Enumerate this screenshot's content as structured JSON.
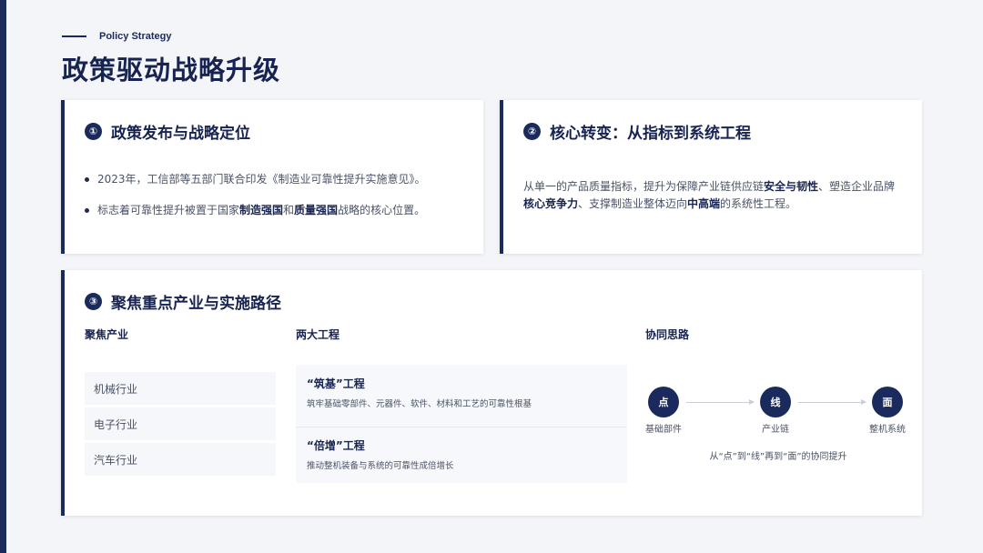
{
  "header": {
    "eyebrow": "Policy Strategy",
    "title": "政策驱动战略升级"
  },
  "card1": {
    "num": "①",
    "title": "政策发布与战略定位",
    "bullet1": "2023年，工信部等五部门联合印发《制造业可靠性提升实施意见》。",
    "bullet2_pre": "标志着可靠性提升被置于国家",
    "bullet2_b1": "制造强国",
    "bullet2_mid": "和",
    "bullet2_b2": "质量强国",
    "bullet2_post": "战略的核心位置。"
  },
  "card2": {
    "num": "②",
    "title": "核心转变：从指标到系统工程",
    "p_pre": "从单一的产品质量指标，提升为保障产业链供应链",
    "p_b1": "安全与韧性",
    "p_mid1": "、塑造企业品牌",
    "p_b2": "核心竞争力",
    "p_mid2": "、支撑制造业整体迈向",
    "p_b3": "中高端",
    "p_post": "的系统性工程。"
  },
  "card3": {
    "num": "③",
    "title": "聚焦重点产业与实施路径",
    "col1_head": "聚焦产业",
    "col2_head": "两大工程",
    "col3_head": "协同思路",
    "industries": [
      "机械行业",
      "电子行业",
      "汽车行业"
    ],
    "projects": [
      {
        "title": "“筑基”工程",
        "desc": "筑牢基础零部件、元器件、软件、材料和工艺的可靠性根基"
      },
      {
        "title": "“倍增”工程",
        "desc": "推动整机装备与系统的可靠性成倍增长"
      }
    ],
    "flow": {
      "nodes": [
        {
          "symbol": "点",
          "label": "基础部件"
        },
        {
          "symbol": "线",
          "label": "产业链"
        },
        {
          "symbol": "面",
          "label": "整机系统"
        }
      ],
      "caption": "从“点”到“线”再到“面”的协同提升"
    }
  }
}
